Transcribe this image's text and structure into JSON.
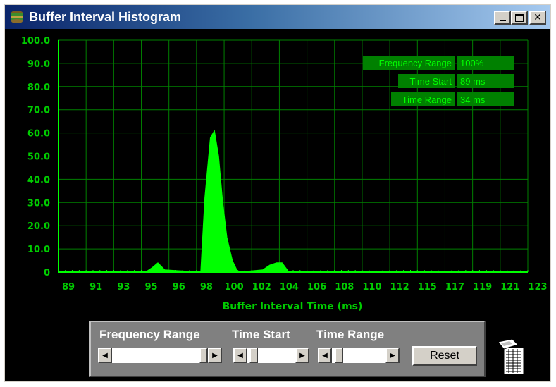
{
  "window": {
    "title": "Buffer Interval Histogram",
    "controls": {
      "minimize_icon": "minimize-icon",
      "maximize_icon": "maximize-icon",
      "close_icon": "close-icon"
    }
  },
  "colors": {
    "plot_green": "#00ff00",
    "grid_green": "#008000",
    "label_green": "#00cc00",
    "background": "#000000"
  },
  "chart_data": {
    "type": "area",
    "title": "",
    "xlabel": "Buffer Interval Time (ms)",
    "ylabel": "",
    "ylim": [
      0,
      100
    ],
    "xlim": [
      89,
      123
    ],
    "x_ticks": [
      "89",
      "91",
      "93",
      "95",
      "96",
      "98",
      "100",
      "102",
      "104",
      "106",
      "108",
      "110",
      "112",
      "115",
      "117",
      "119",
      "121",
      "123"
    ],
    "x_tick_values": [
      89,
      91,
      93,
      95,
      96,
      98,
      100,
      102,
      104,
      106,
      108,
      110,
      112,
      115,
      117,
      119,
      121,
      123
    ],
    "y_ticks": [
      "100.0",
      "90.0",
      "80.0",
      "70.0",
      "60.0",
      "50.0",
      "40.0",
      "30.0",
      "20.0",
      "10.0",
      "0"
    ],
    "y_tick_values": [
      100,
      90,
      80,
      70,
      60,
      50,
      40,
      30,
      20,
      10,
      0
    ],
    "grid": true,
    "series": [
      {
        "x": [
          95.3,
          95.8,
          96.2,
          96.7,
          99.3,
          99.6,
          100.0,
          100.3,
          100.6,
          100.9,
          101.2,
          101.6,
          102.0,
          103.8,
          104.3,
          104.8,
          105.2,
          105.7
        ],
        "values": [
          0,
          2,
          4,
          1,
          0,
          32,
          58,
          61,
          50,
          30,
          15,
          5,
          0,
          1,
          3,
          4,
          4,
          0
        ]
      }
    ],
    "info_boxes": [
      {
        "label": "Frequency Range",
        "value": "100%"
      },
      {
        "label": "Time Start",
        "value": "89 ms"
      },
      {
        "label": "Time Range",
        "value": "34 ms"
      }
    ]
  },
  "controls": {
    "frequency_range_label": "Frequency Range",
    "time_start_label": "Time Start",
    "time_range_label": "Time Range",
    "reset_label": "Reset",
    "frequency_range_value": 1.0,
    "time_start_value": 0.06,
    "time_range_value": 0.06
  },
  "icons": {
    "app": "app-icon",
    "print": "printer-icon"
  }
}
